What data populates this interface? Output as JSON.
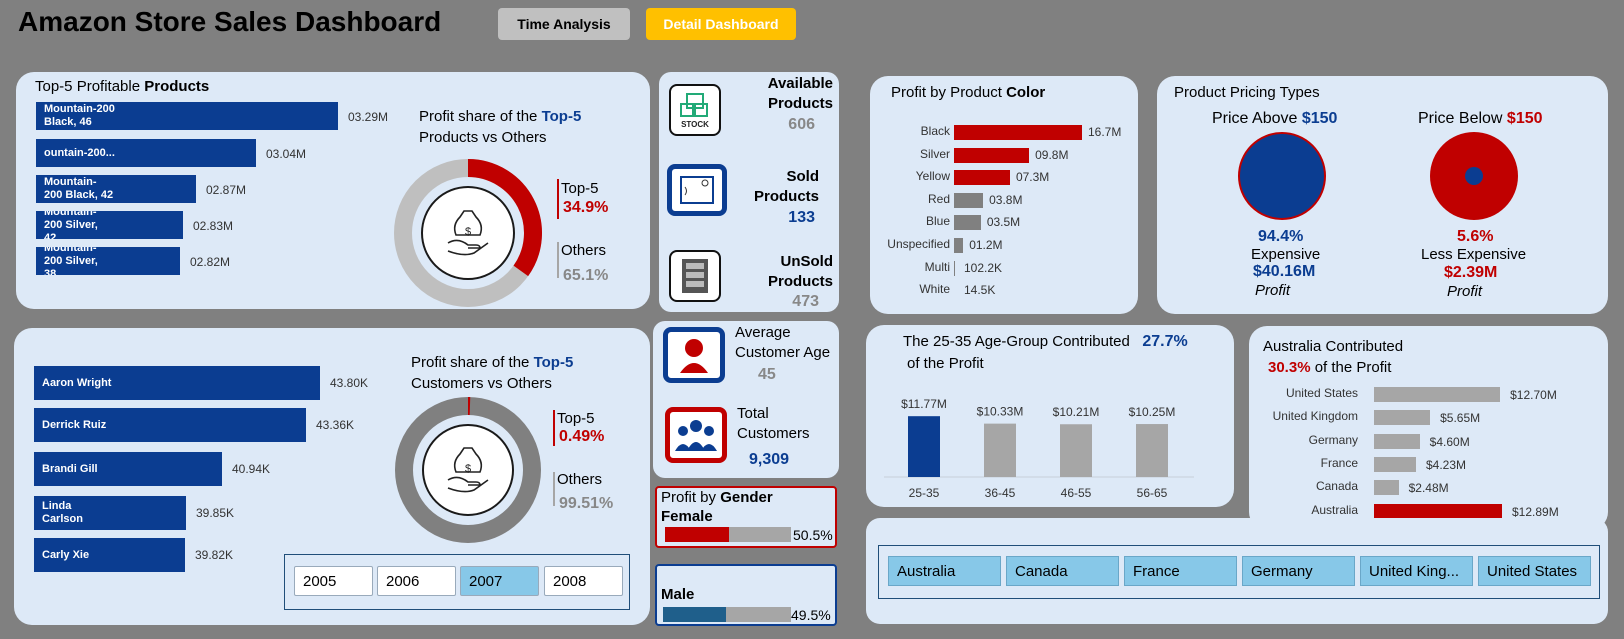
{
  "header": {
    "title": "Amazon Store Sales Dashboard",
    "btn_time": "Time Analysis",
    "btn_detail": "Detail Dashboard"
  },
  "colors": {
    "blue": "#0b3d91",
    "red": "#c00000",
    "grey": "#a6a6a6",
    "card": "#dde9f7",
    "accent_btn": "#ffc000"
  },
  "top_products": {
    "title_plain": "Top-5 Profitable ",
    "title_bold": "Products",
    "items": [
      {
        "label": "Mountain-200\nBlack, 46",
        "value": "03.29M"
      },
      {
        "label": "ountain-200...",
        "value": "03.04M"
      },
      {
        "label": "Mountain-\n200 Black, 42",
        "value": "02.87M"
      },
      {
        "label": "Mountain-\n200 Silver,\n42",
        "value": "02.83M"
      },
      {
        "label": "Mountain-\n200 Silver,\n38",
        "value": "02.82M"
      }
    ],
    "share_title_a": "Profit share of the ",
    "share_title_b": "Top-5",
    "share_title_c": "Products vs Others",
    "top5_label": "Top-5",
    "top5_pct": "34.9%",
    "others_label": "Others",
    "others_pct": "65.1%",
    "donut_fraction": 0.349
  },
  "kpis": {
    "available_label": "Available\nProducts",
    "available_value": "606",
    "sold_label": "Sold\nProducts",
    "sold_value": "133",
    "unsold_label": "UnSold\nProducts",
    "unsold_value": "473",
    "stock_icon_text": "STOCK",
    "avg_age_label": "Average\nCustomer Age",
    "avg_age_value": "45",
    "total_cust_label": "Total\nCustomers",
    "total_cust_value": "9,309"
  },
  "gender": {
    "title_plain": "Profit by ",
    "title_bold": "Gender",
    "female_label": "Female",
    "female_pct": "50.5%",
    "female_fraction": 0.505,
    "male_label": "Male",
    "male_pct": "49.5%",
    "male_fraction": 0.495
  },
  "color_chart": {
    "title_plain": "Profit by Product ",
    "title_bold": "Color",
    "items": [
      {
        "label": "Black",
        "value": "16.7M",
        "num": 16.7,
        "color": "#c00000"
      },
      {
        "label": "Silver",
        "value": "09.8M",
        "num": 9.8,
        "color": "#c00000"
      },
      {
        "label": "Yellow",
        "value": "07.3M",
        "num": 7.3,
        "color": "#c00000"
      },
      {
        "label": "Red",
        "value": "03.8M",
        "num": 3.8,
        "color": "#808080"
      },
      {
        "label": "Blue",
        "value": "03.5M",
        "num": 3.5,
        "color": "#808080"
      },
      {
        "label": "Unspecified",
        "value": "01.2M",
        "num": 1.2,
        "color": "#808080"
      },
      {
        "label": "Multi",
        "value": "102.2K",
        "num": 0.1022,
        "color": "#808080"
      },
      {
        "label": "White",
        "value": "14.5K",
        "num": 0.0145,
        "color": "#808080"
      }
    ]
  },
  "pricing": {
    "title": "Product Pricing Types",
    "above_a": "Price Above ",
    "above_b": "$150",
    "below_a": "Price Below ",
    "below_b": "$150",
    "above_pct": "94.4%",
    "above_type": "Expensive",
    "above_profit": "$40.16M",
    "above_profit_lbl": "Profit",
    "below_pct": "5.6%",
    "below_type": "Less Expensive",
    "below_profit": "$2.39M",
    "below_profit_lbl": "Profit"
  },
  "top_customers": {
    "items": [
      {
        "label": "Aaron Wright",
        "value": "43.80K"
      },
      {
        "label": "Derrick Ruiz",
        "value": "43.36K"
      },
      {
        "label": "Brandi Gill",
        "value": "40.94K"
      },
      {
        "label": "Linda\nCarlson",
        "value": "39.85K"
      },
      {
        "label": "Carly Xie",
        "value": "39.82K"
      }
    ],
    "share_title_a": "Profit share of the ",
    "share_title_b": "Top-5",
    "share_title_c": "Customers  vs Others",
    "top5_label": "Top-5",
    "top5_pct": "0.49%",
    "others_label": "Others",
    "others_pct": "99.51%",
    "donut_fraction": 0.0049
  },
  "years": [
    "2005",
    "2006",
    "2007",
    "2008"
  ],
  "age_chart": {
    "title_a": "The 25-35 Age-Group Contributed",
    "title_pct": "27.7%",
    "title_b": "of the Profit",
    "chart_data": {
      "type": "bar",
      "categories": [
        "25-35",
        "36-45",
        "46-55",
        "56-65"
      ],
      "values": [
        11.77,
        10.33,
        10.21,
        10.25
      ],
      "labels": [
        "$11.77M",
        "$10.33M",
        "$10.21M",
        "$10.25M"
      ]
    }
  },
  "country_chart": {
    "title_a": "Australia Contributed",
    "title_pct": "30.3%",
    "title_b": " of the Profit",
    "items": [
      {
        "label": "United States",
        "value": "$12.70M",
        "num": 12.7,
        "color": "#a6a6a6"
      },
      {
        "label": "United Kingdom",
        "value": "$5.65M",
        "num": 5.65,
        "color": "#a6a6a6"
      },
      {
        "label": "Germany",
        "value": "$4.60M",
        "num": 4.6,
        "color": "#a6a6a6"
      },
      {
        "label": "France",
        "value": "$4.23M",
        "num": 4.23,
        "color": "#a6a6a6"
      },
      {
        "label": "Canada",
        "value": "$2.48M",
        "num": 2.48,
        "color": "#a6a6a6"
      },
      {
        "label": "Australia",
        "value": "$12.89M",
        "num": 12.89,
        "color": "#c00000"
      }
    ]
  },
  "countries": [
    "Australia",
    "Canada",
    "France",
    "Germany",
    "United King...",
    "United States"
  ]
}
